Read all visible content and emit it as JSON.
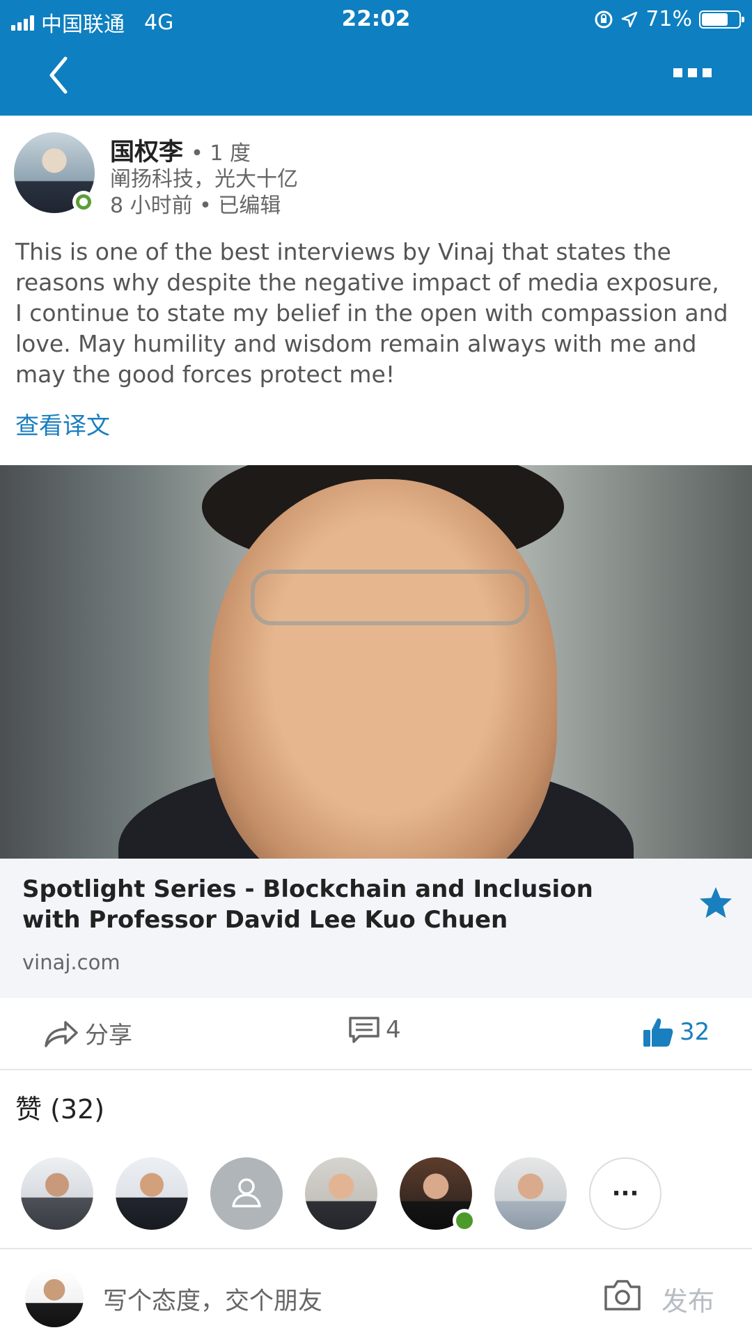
{
  "status_bar": {
    "carrier": "中国联通",
    "network": "4G",
    "time": "22:02",
    "battery_percent": "71%",
    "battery_level": 0.71
  },
  "nav": {
    "back_icon": "chevron-left-icon",
    "more_icon": "more-dots-icon",
    "bar_color": "#0e7fc0"
  },
  "post": {
    "author_name": "国权李",
    "degree": "• 1 度",
    "headline": "阐扬科技，光大十亿",
    "meta": "8 小时前 • 已编辑",
    "text": "This is one of the best interviews by Vinaj that states the reasons why despite the negative impact of media exposure, I continue to state my belief in the open with compassion and love. May humility and wisdom remain always with me and may the good forces protect me!",
    "translate_label": "查看译文"
  },
  "link_card": {
    "title": "Spotlight Series - Blockchain and Inclusion with Professor David Lee Kuo Chuen",
    "domain": "vinaj.com",
    "star_icon": "star-icon"
  },
  "actions": {
    "share_label": "分享",
    "comment_count": "4",
    "like_count": "32",
    "accent_color": "#1a7fbe"
  },
  "likes": {
    "title": "赞 (32)",
    "more_label": "···"
  },
  "compose": {
    "placeholder": "写个态度，交个朋友",
    "publish_label": "发布",
    "camera_icon": "camera-icon"
  }
}
